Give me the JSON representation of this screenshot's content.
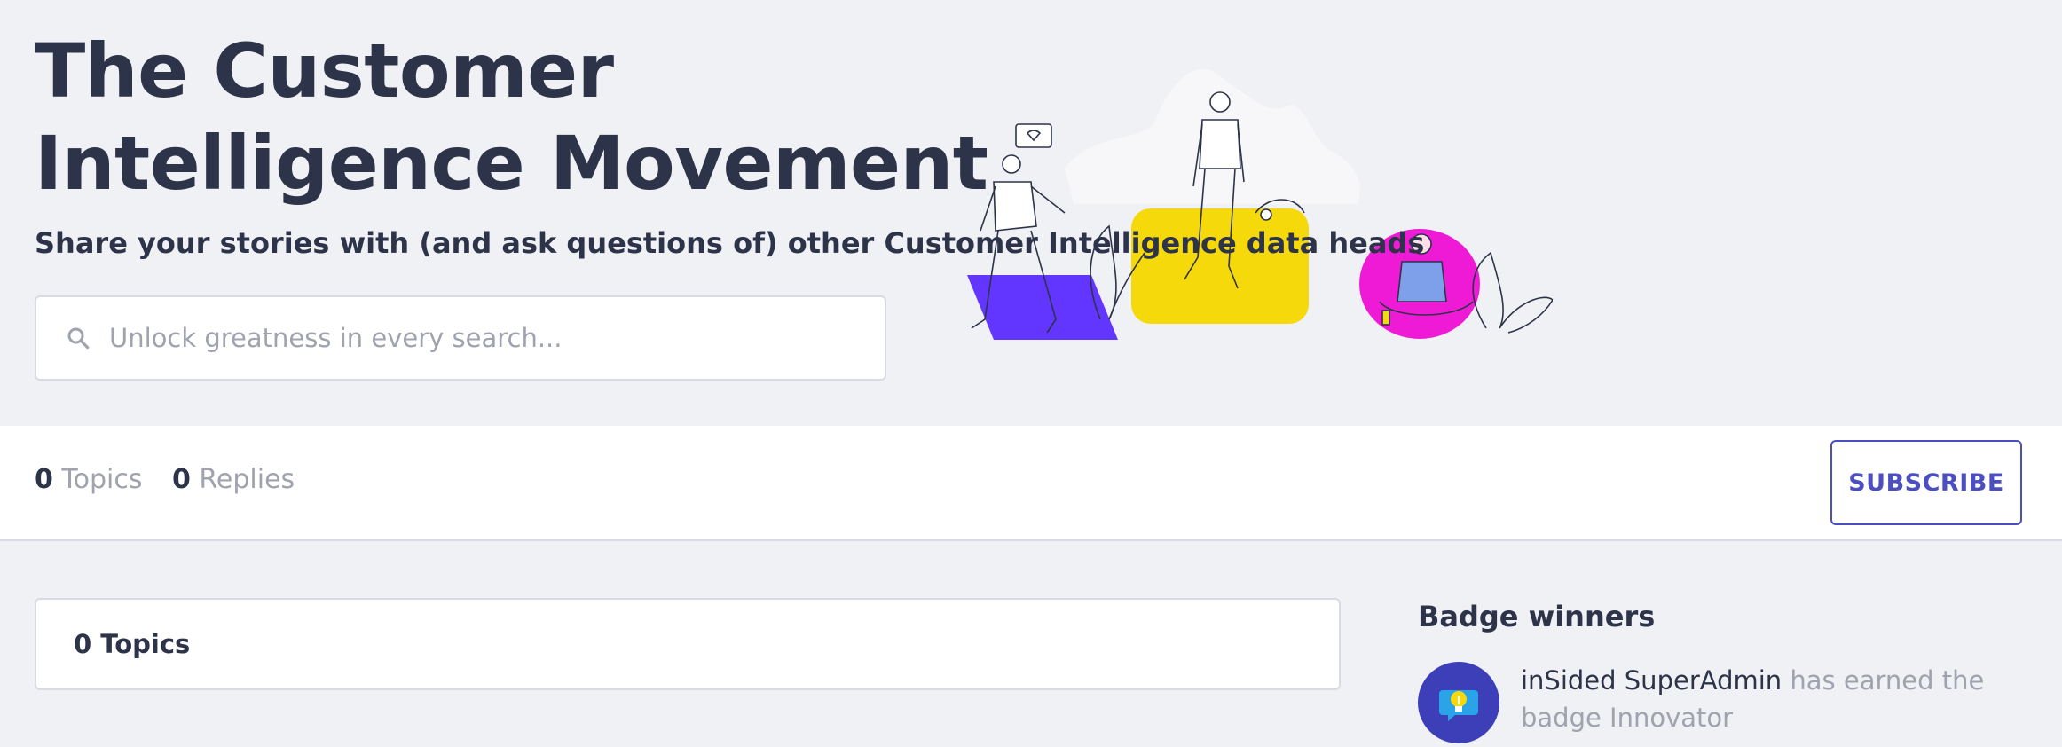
{
  "hero": {
    "title": "The Customer Intelligence Movement",
    "subtitle": "Share your stories with (and ask questions of) other Customer Intelligence data heads"
  },
  "search": {
    "placeholder": "Unlock greatness in every search...",
    "icon": "search-icon"
  },
  "stats": {
    "topics_count": "0",
    "topics_label": "Topics",
    "replies_count": "0",
    "replies_label": "Replies"
  },
  "subscribe": {
    "label": "SUBSCRIBE"
  },
  "topics_panel": {
    "heading": "0 Topics"
  },
  "badge_winners": {
    "title": "Badge winners",
    "entries": [
      {
        "user": "inSided SuperAdmin",
        "text": "has earned the badge Innovator",
        "icon": "lightbulb-badge-icon"
      }
    ]
  },
  "colors": {
    "background": "#f0f1f5",
    "text_dark": "#2d3348",
    "text_muted": "#9fa3ae",
    "accent": "#4b4fc0",
    "illustration_purple": "#6236ff",
    "illustration_yellow": "#f5d90a",
    "illustration_magenta": "#ee1ad6"
  }
}
